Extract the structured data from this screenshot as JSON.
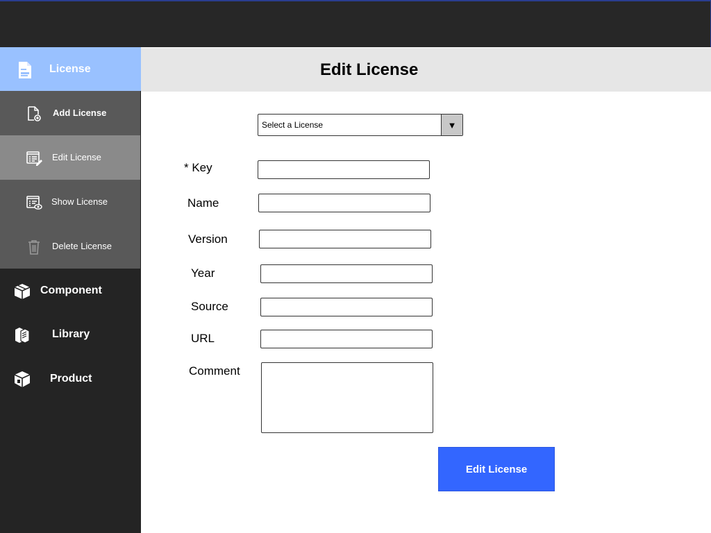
{
  "sidebar": {
    "license": {
      "label": "License",
      "icon": "license-document-icon"
    },
    "license_submenu": [
      {
        "label": "Add License",
        "icon": "file-add-icon"
      },
      {
        "label": "Edit License",
        "icon": "list-edit-icon",
        "selected": true
      },
      {
        "label": "Show License",
        "icon": "list-view-icon"
      },
      {
        "label": "Delete License",
        "icon": "trash-icon"
      }
    ],
    "items": [
      {
        "label": "Component",
        "icon": "box-icon"
      },
      {
        "label": "Library",
        "icon": "books-icon"
      },
      {
        "label": "Product",
        "icon": "package-icon"
      }
    ]
  },
  "header": {
    "title": "Edit License"
  },
  "form": {
    "license_select": {
      "value": "Select a License",
      "arrow": "▼"
    },
    "fields": {
      "key": {
        "label": "* Key",
        "value": ""
      },
      "name": {
        "label": "Name",
        "value": ""
      },
      "version": {
        "label": "Version",
        "value": ""
      },
      "year": {
        "label": "Year",
        "value": ""
      },
      "source": {
        "label": "Source",
        "value": ""
      },
      "url": {
        "label": "URL",
        "value": ""
      },
      "comment": {
        "label": "Comment",
        "value": ""
      }
    },
    "submit_label": "Edit License"
  },
  "colors": {
    "topbar": "#272727",
    "sidebar": "#242424",
    "active_section": "#99c1ff",
    "submenu": "#595959",
    "submenu_selected": "#8a8a8a",
    "header": "#e6e6e6",
    "accent": "#3366ff"
  }
}
